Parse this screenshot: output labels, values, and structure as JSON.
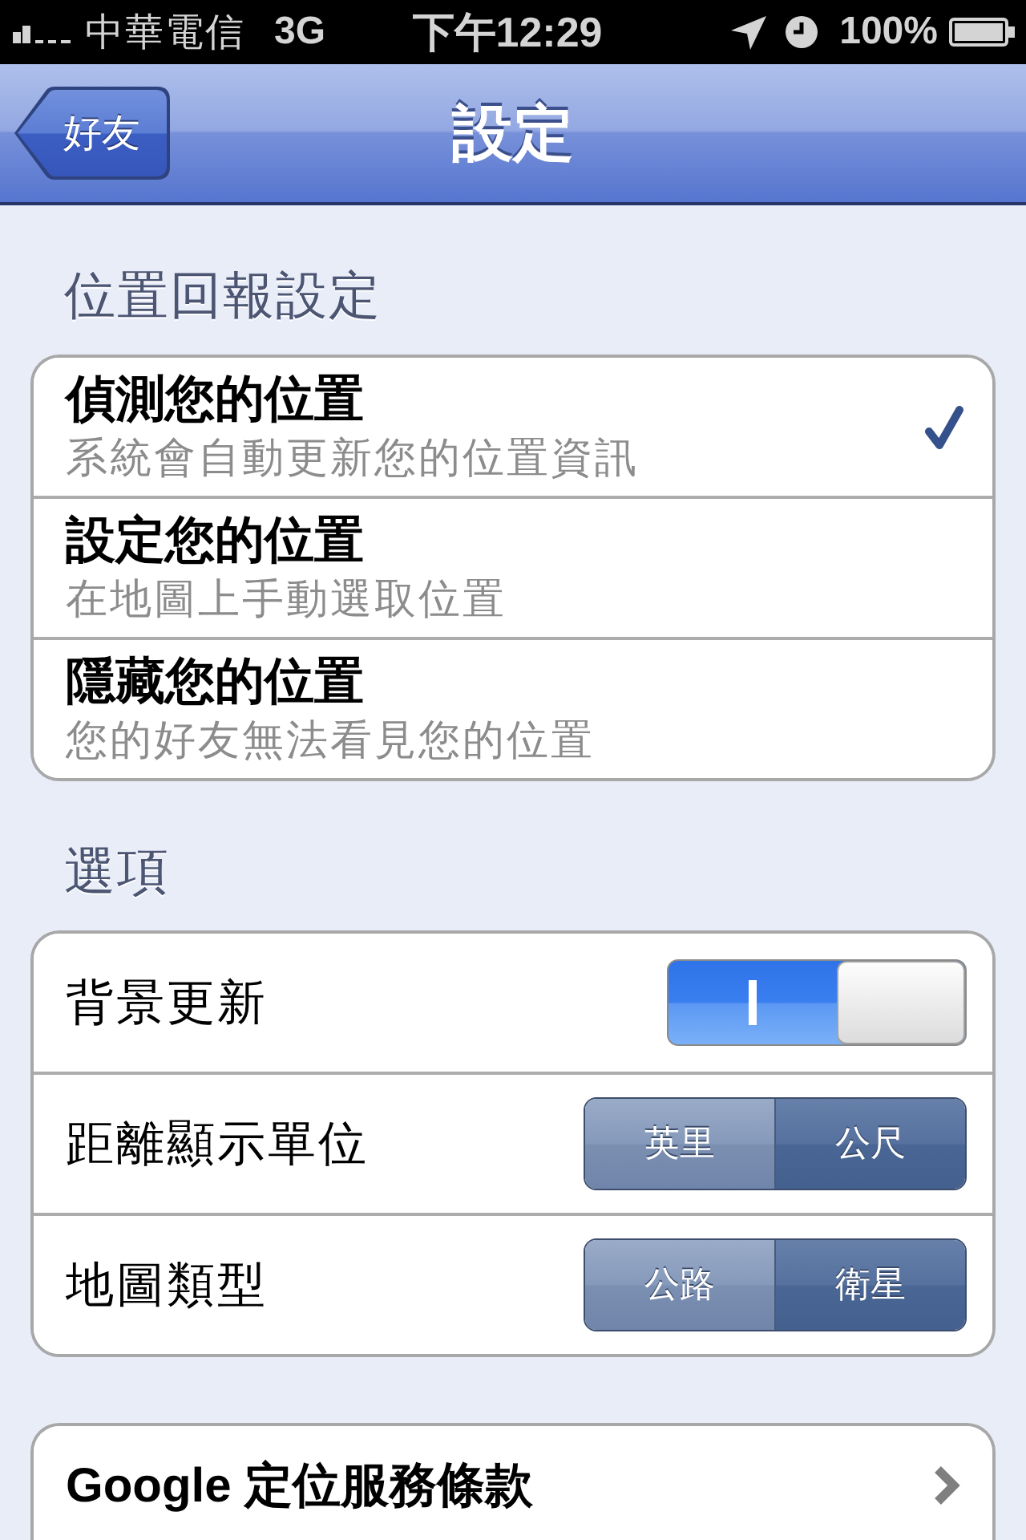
{
  "status_bar": {
    "carrier": "中華電信",
    "network": "3G",
    "time": "下午12:29",
    "battery": "100%"
  },
  "nav_bar": {
    "back": "好友",
    "title": "設定"
  },
  "sections": [
    {
      "header": "位置回報設定",
      "rows": [
        {
          "kind": "choice",
          "title": "偵測您的位置",
          "subtitle": "系統會自動更新您的位置資訊",
          "selected": true
        },
        {
          "kind": "choice",
          "title": "設定您的位置",
          "subtitle": "在地圖上手動選取位置",
          "selected": false
        },
        {
          "kind": "choice",
          "title": "隱藏您的位置",
          "subtitle": "您的好友無法看見您的位置",
          "selected": false
        }
      ]
    },
    {
      "header": "選項",
      "rows": [
        {
          "kind": "toggle",
          "label": "背景更新",
          "on": true
        },
        {
          "kind": "segmented",
          "label": "距離顯示單位",
          "segments": [
            {
              "label": "英里",
              "selected": false
            },
            {
              "label": "公尺",
              "selected": true
            }
          ]
        },
        {
          "kind": "segmented",
          "label": "地圖類型",
          "segments": [
            {
              "label": "公路",
              "selected": false
            },
            {
              "label": "衛星",
              "selected": true
            }
          ]
        }
      ]
    },
    {
      "rows": [
        {
          "kind": "link",
          "label": "Google 定位服務條款"
        }
      ]
    }
  ]
}
